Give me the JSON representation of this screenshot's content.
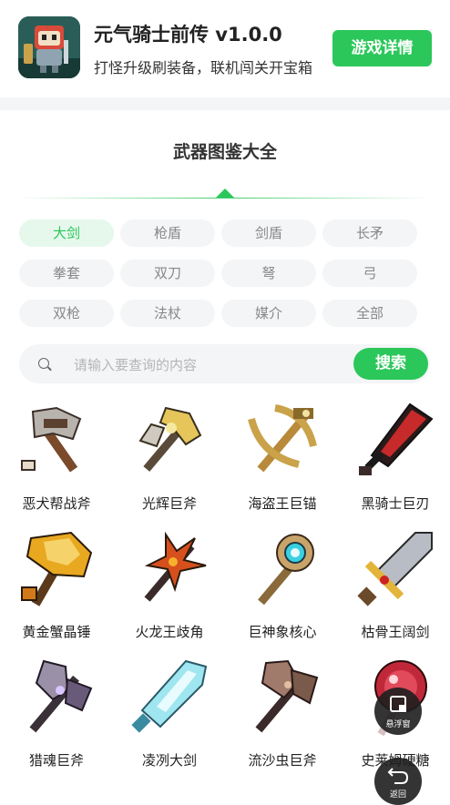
{
  "app": {
    "title": "元气骑士前传 v1.0.0",
    "subtitle": "打怪升级刷装备，联机闯关开宝箱",
    "detail_button": "游戏详情"
  },
  "section": {
    "title": "武器图鉴大全"
  },
  "categories": [
    {
      "label": "大剑",
      "active": true
    },
    {
      "label": "枪盾",
      "active": false
    },
    {
      "label": "剑盾",
      "active": false
    },
    {
      "label": "长矛",
      "active": false
    },
    {
      "label": "拳套",
      "active": false
    },
    {
      "label": "双刀",
      "active": false
    },
    {
      "label": "弩",
      "active": false
    },
    {
      "label": "弓",
      "active": false
    },
    {
      "label": "双枪",
      "active": false
    },
    {
      "label": "法杖",
      "active": false
    },
    {
      "label": "媒介",
      "active": false
    },
    {
      "label": "全部",
      "active": false
    }
  ],
  "search": {
    "placeholder": "请输入要查询的内容",
    "value": "",
    "button": "搜索"
  },
  "weapons": [
    {
      "name": "恶犬帮战斧"
    },
    {
      "name": "光辉巨斧"
    },
    {
      "name": "海盗王巨锚"
    },
    {
      "name": "黑骑士巨刃"
    },
    {
      "name": "黄金蟹晶锤"
    },
    {
      "name": "火龙王歧角"
    },
    {
      "name": "巨神象核心"
    },
    {
      "name": "枯骨王阔剑"
    },
    {
      "name": "猎魂巨斧"
    },
    {
      "name": "凌冽大剑"
    },
    {
      "name": "流沙虫巨斧"
    },
    {
      "name": "史莱姆硬糖"
    }
  ],
  "floating": {
    "float_label": "悬浮窗",
    "back_label": "返回"
  },
  "colors": {
    "accent": "#2bc75a",
    "chip_bg": "#f4f5f7",
    "chip_active_bg": "#e6f8ec"
  }
}
